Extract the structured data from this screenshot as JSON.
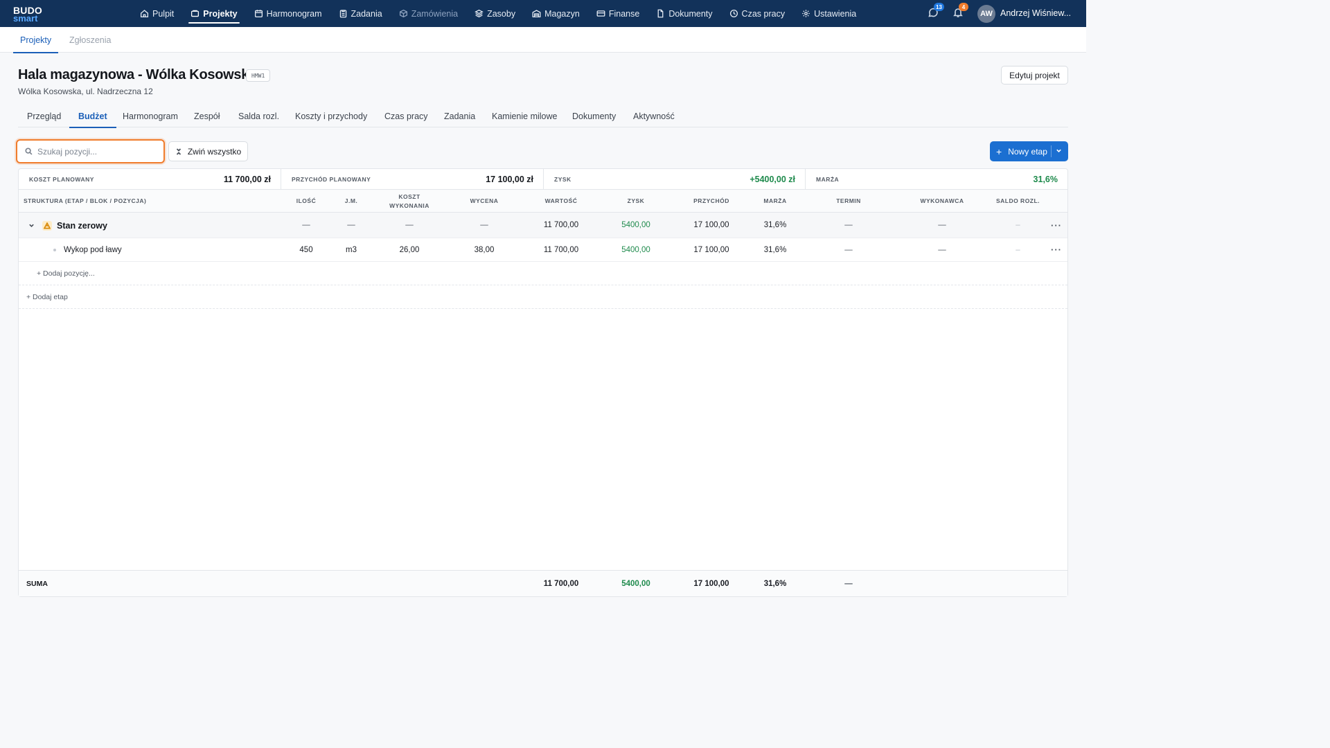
{
  "brand": {
    "line1": "BUDO",
    "line2": "smart"
  },
  "nav": [
    {
      "label": "Pulpit",
      "icon": "home-icon",
      "state": "normal"
    },
    {
      "label": "Projekty",
      "icon": "folder-icon",
      "state": "active"
    },
    {
      "label": "Harmonogram",
      "icon": "calendar-icon",
      "state": "normal"
    },
    {
      "label": "Zadania",
      "icon": "clipboard-icon",
      "state": "normal"
    },
    {
      "label": "Zamówienia",
      "icon": "box-icon",
      "state": "muted"
    },
    {
      "label": "Zasoby",
      "icon": "layers-icon",
      "state": "normal"
    },
    {
      "label": "Magazyn",
      "icon": "warehouse-icon",
      "state": "normal"
    },
    {
      "label": "Finanse",
      "icon": "card-icon",
      "state": "normal"
    },
    {
      "label": "Dokumenty",
      "icon": "documents-icon",
      "state": "normal"
    },
    {
      "label": "Czas pracy",
      "icon": "clock-icon",
      "state": "normal"
    },
    {
      "label": "Ustawienia",
      "icon": "gear-icon",
      "state": "normal"
    }
  ],
  "topbar": {
    "messages_count": "13",
    "notifications_count": "4",
    "avatar_initials": "AW",
    "user_name": "Andrzej Wiśniew..."
  },
  "subtabs": [
    {
      "label": "Projekty",
      "active": true
    },
    {
      "label": "Zgłoszenia",
      "active": false
    }
  ],
  "project": {
    "title": "Hala magazynowa - Wólka Kosowska",
    "code": "HMW1",
    "address": "Wólka Kosowska, ul. Nadrzeczna 12",
    "edit_label": "Edytuj projekt"
  },
  "project_tabs": [
    {
      "label": "Przegląd",
      "active": false
    },
    {
      "label": "Budżet",
      "active": true
    },
    {
      "label": "Harmonogram",
      "active": false
    },
    {
      "label": "Zespół",
      "active": false
    },
    {
      "label": "Salda rozl.",
      "active": false
    },
    {
      "label": "Koszty i przychody",
      "active": false
    },
    {
      "label": "Czas pracy",
      "active": false
    },
    {
      "label": "Zadania",
      "active": false
    },
    {
      "label": "Kamienie milowe",
      "active": false
    },
    {
      "label": "Dokumenty",
      "active": false
    },
    {
      "label": "Aktywność",
      "active": false
    }
  ],
  "toolbar": {
    "search_placeholder": "Szukaj pozycji...",
    "search_value": "",
    "collapse_label": "Zwiń wszystko",
    "new_stage_label": "Nowy etap"
  },
  "kpis": [
    {
      "label": "KOSZT PLANOWANY",
      "value": "11 700,00 zł"
    },
    {
      "label": "PRZYCHÓD PLANOWANY",
      "value": "17 100,00 zł"
    },
    {
      "label": "ZYSK",
      "value": "+5400,00 zł"
    },
    {
      "label": "MARŻA",
      "value": "31,6%"
    }
  ],
  "columns": {
    "structure": "STRUKTURA (ETAP / BLOK / POZYCJA)",
    "qty": "ILOŚĆ",
    "unit": "J.M.",
    "cost": "KOSZT WYKONANIA",
    "price": "WYCENA",
    "value": "WARTOŚĆ",
    "profit": "ZYSK",
    "revenue": "PRZYCHÓD",
    "margin": "MARŻA",
    "deadline": "TERMIN",
    "contractor": "WYKONAWCA",
    "balance": "SALDO ROZL."
  },
  "stage": {
    "name": "Stan zerowy",
    "qty": "—",
    "unit": "—",
    "cost": "—",
    "price": "—",
    "value": "11 700,00",
    "profit": "5400,00",
    "revenue": "17 100,00",
    "margin": "31,6%",
    "deadline": "—",
    "contractor": "—",
    "balance": "–",
    "menu": "···"
  },
  "item": {
    "name": "Wykop pod ławy",
    "qty": "450",
    "unit": "m3",
    "cost": "26,00",
    "price": "38,00",
    "value": "11 700,00",
    "profit": "5400,00",
    "revenue": "17 100,00",
    "margin": "31,6%",
    "deadline": "—",
    "contractor": "—",
    "balance": "–",
    "menu": "···"
  },
  "add_position_label": "+ Dodaj pozycję...",
  "add_stage_label": "+ Dodaj etap",
  "totals": {
    "label": "SUMA",
    "value": "11 700,00",
    "profit": "5400,00",
    "revenue": "17 100,00",
    "margin": "31,6%",
    "deadline": "—"
  },
  "colors": {
    "topbar": "#12325a",
    "accent": "#1b6fd1",
    "profit_green": "#1e8a4c",
    "focus_orange": "#f07c2c"
  }
}
